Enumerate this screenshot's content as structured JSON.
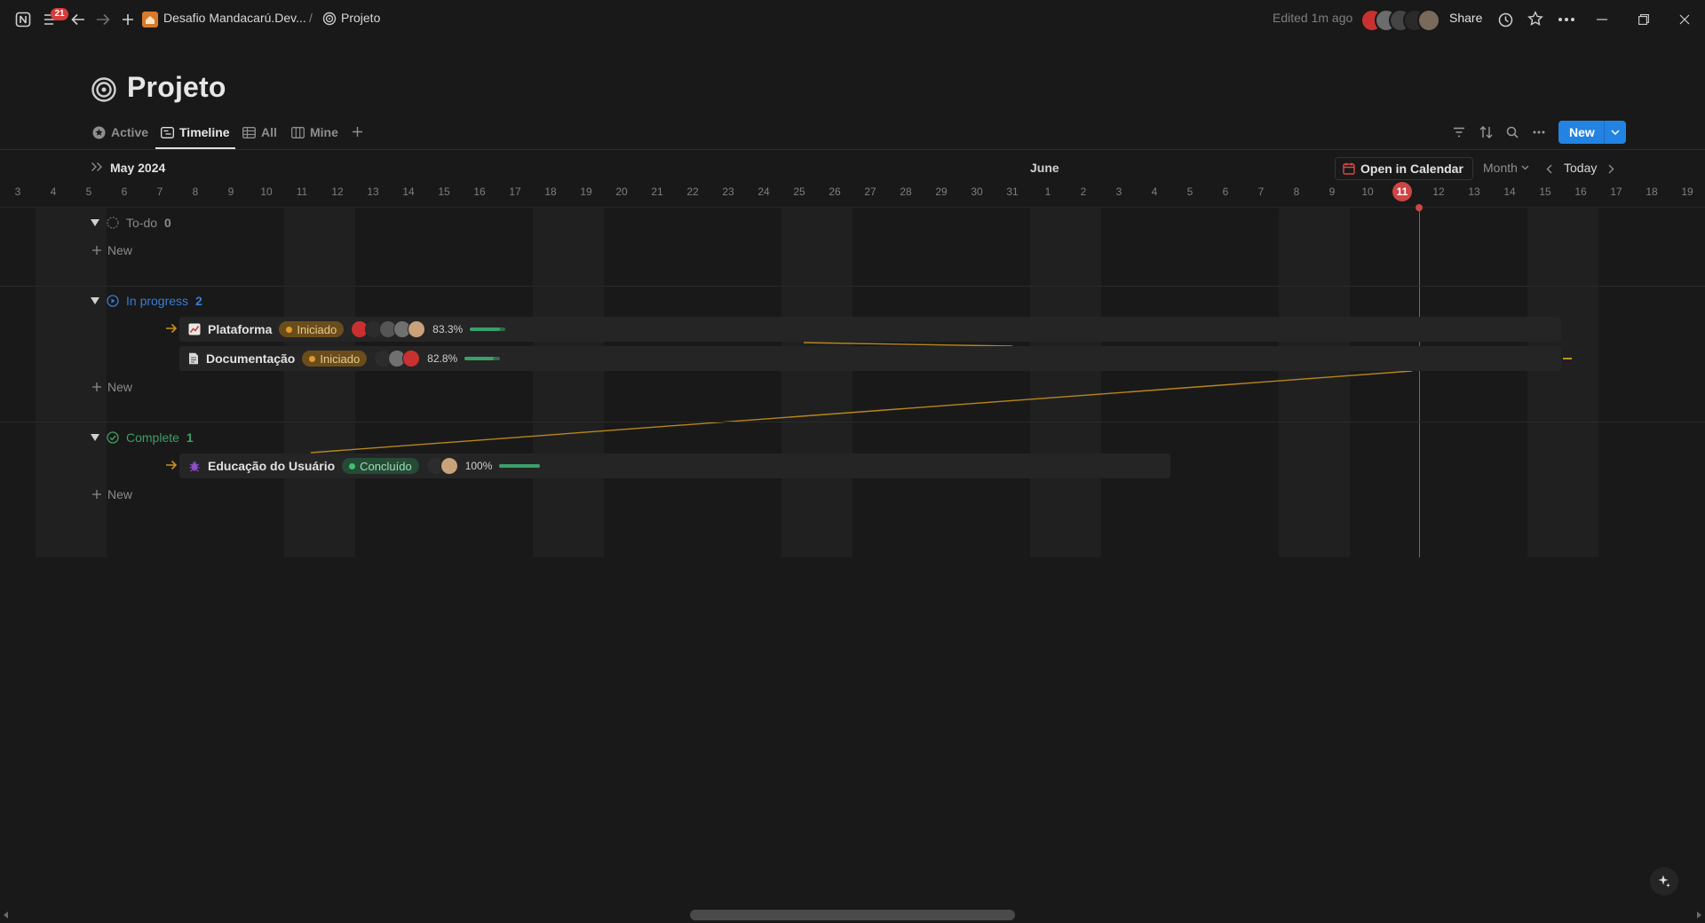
{
  "topbar": {
    "notification_count": "21",
    "workspace_crumb": "Desafio Mandacarú.Dev...",
    "separator": "/",
    "page_crumb": "Projeto",
    "edited": "Edited 1m ago",
    "share": "Share"
  },
  "page": {
    "title": "Projeto"
  },
  "tabs": [
    {
      "label": "Active",
      "icon": "star-circle-icon"
    },
    {
      "label": "Timeline",
      "icon": "timeline-icon"
    },
    {
      "label": "All",
      "icon": "table-icon"
    },
    {
      "label": "Mine",
      "icon": "board-icon"
    }
  ],
  "toolbar": {
    "new_label": "New"
  },
  "timeline": {
    "month_start": "May 2024",
    "month_next": "June",
    "open_in_calendar": "Open in Calendar",
    "scale": "Month",
    "today_label": "Today",
    "today_day": "11",
    "days": [
      "3",
      "4",
      "5",
      "6",
      "7",
      "8",
      "9",
      "10",
      "11",
      "12",
      "13",
      "14",
      "15",
      "16",
      "17",
      "18",
      "19",
      "20",
      "21",
      "22",
      "23",
      "24",
      "25",
      "26",
      "27",
      "28",
      "29",
      "30",
      "31",
      "1",
      "2",
      "3",
      "4",
      "5",
      "6",
      "7",
      "8",
      "9",
      "10",
      "11",
      "12",
      "13",
      "14",
      "15",
      "16",
      "17",
      "18",
      "19"
    ]
  },
  "groups": [
    {
      "label": "To-do",
      "count": "0",
      "color": "#8a8a8a",
      "new_label": "New",
      "items": []
    },
    {
      "label": "In progress",
      "count": "2",
      "color": "#3b7bd6",
      "new_label": "New",
      "items": [
        {
          "name": "Plataforma",
          "icon": "chart-icon",
          "status": "Iniciado",
          "percent": "83.3%",
          "progress": 0.833
        },
        {
          "name": "Documentação",
          "icon": "document-icon",
          "status": "Iniciado",
          "percent": "82.8%",
          "progress": 0.828
        }
      ]
    },
    {
      "label": "Complete",
      "count": "1",
      "color": "#3f9e63",
      "new_label": "New",
      "items": [
        {
          "name": "Educação do Usuário",
          "icon": "bug-icon",
          "status": "Concluído",
          "percent": "100%",
          "progress": 1.0
        }
      ]
    }
  ],
  "colors": {
    "accent": "#2383e2",
    "status_started_bg": "#6b4d1c",
    "status_started_text": "#e8c98c",
    "status_done_bg": "#254a35",
    "status_done_text": "#9fdcb5",
    "today": "#cd4545",
    "dependency_line": "#c8901d"
  }
}
